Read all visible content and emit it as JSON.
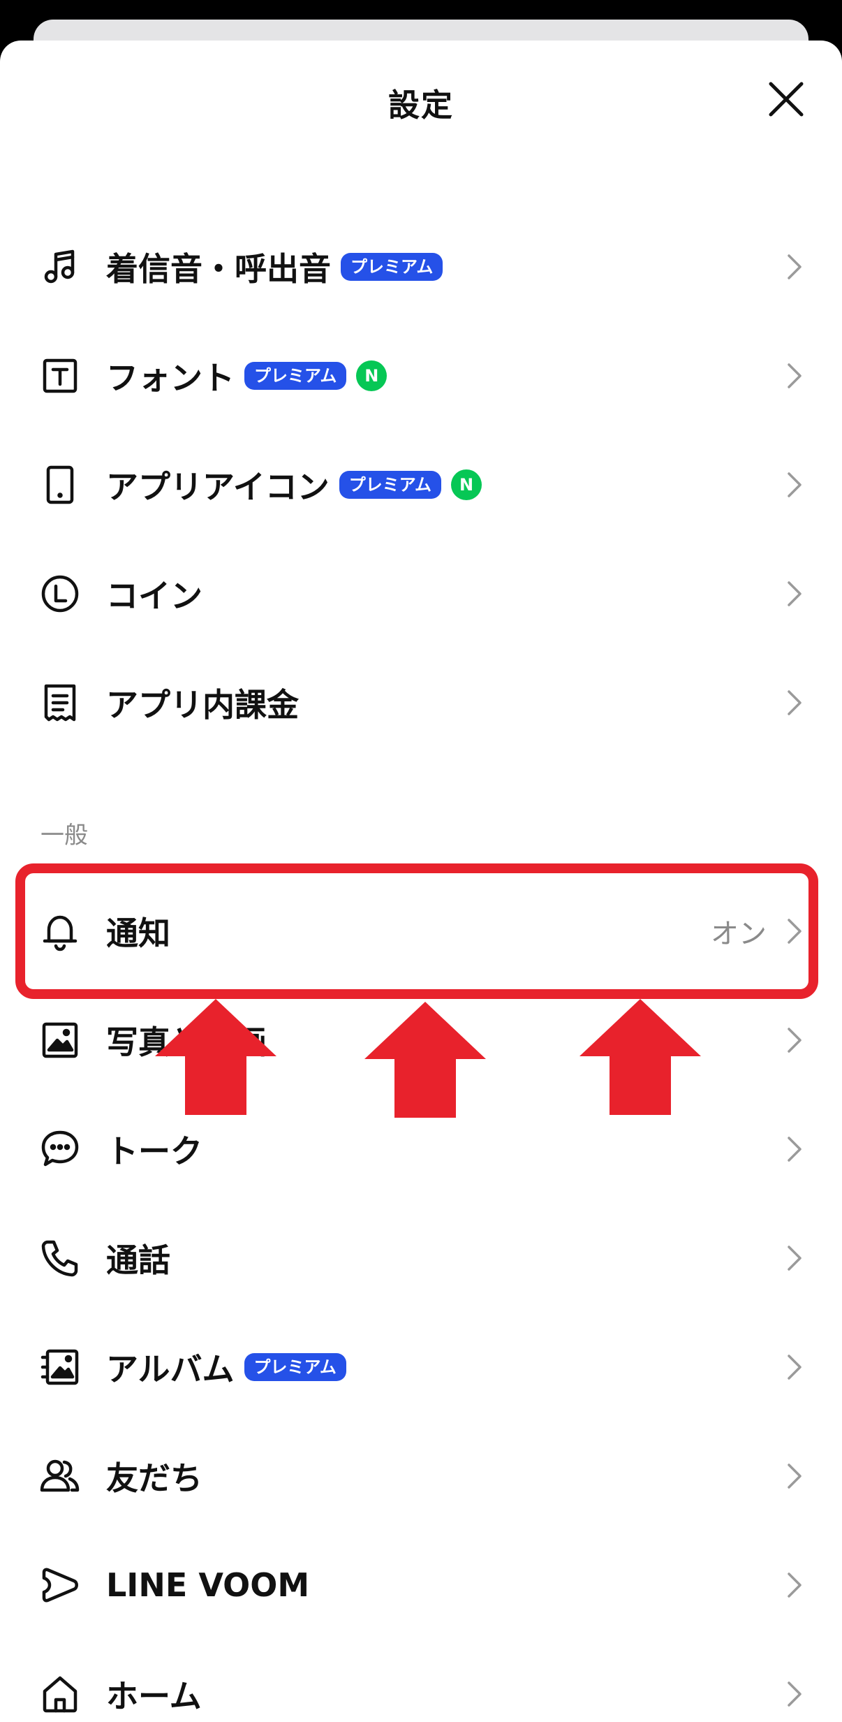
{
  "header": {
    "title": "設定"
  },
  "colors": {
    "premium_badge": "#2551e8",
    "new_badge": "#06c755",
    "highlight": "#e8222c"
  },
  "items": [
    {
      "label": "着信音・呼出音",
      "icon": "music-note-icon",
      "premium": "プレミアム"
    },
    {
      "label": "フォント",
      "icon": "font-icon",
      "premium": "プレミアム",
      "new": "N"
    },
    {
      "label": "アプリアイコン",
      "icon": "phone-device-icon",
      "premium": "プレミアム",
      "new": "N"
    },
    {
      "label": "コイン",
      "icon": "coin-icon"
    },
    {
      "label": "アプリ内課金",
      "icon": "receipt-icon"
    }
  ],
  "general": {
    "section_label": "一般",
    "items": [
      {
        "label": "通知",
        "icon": "bell-icon",
        "value": "オン"
      },
      {
        "label": "写真と動画",
        "icon": "photo-icon"
      },
      {
        "label": "トーク",
        "icon": "chat-bubble-icon"
      },
      {
        "label": "通話",
        "icon": "phone-icon"
      },
      {
        "label": "アルバム",
        "icon": "album-icon",
        "premium": "プレミアム"
      },
      {
        "label": "友だち",
        "icon": "friends-icon"
      },
      {
        "label": "LINE VOOM",
        "icon": "voom-icon"
      },
      {
        "label": "ホーム",
        "icon": "home-icon"
      }
    ]
  }
}
